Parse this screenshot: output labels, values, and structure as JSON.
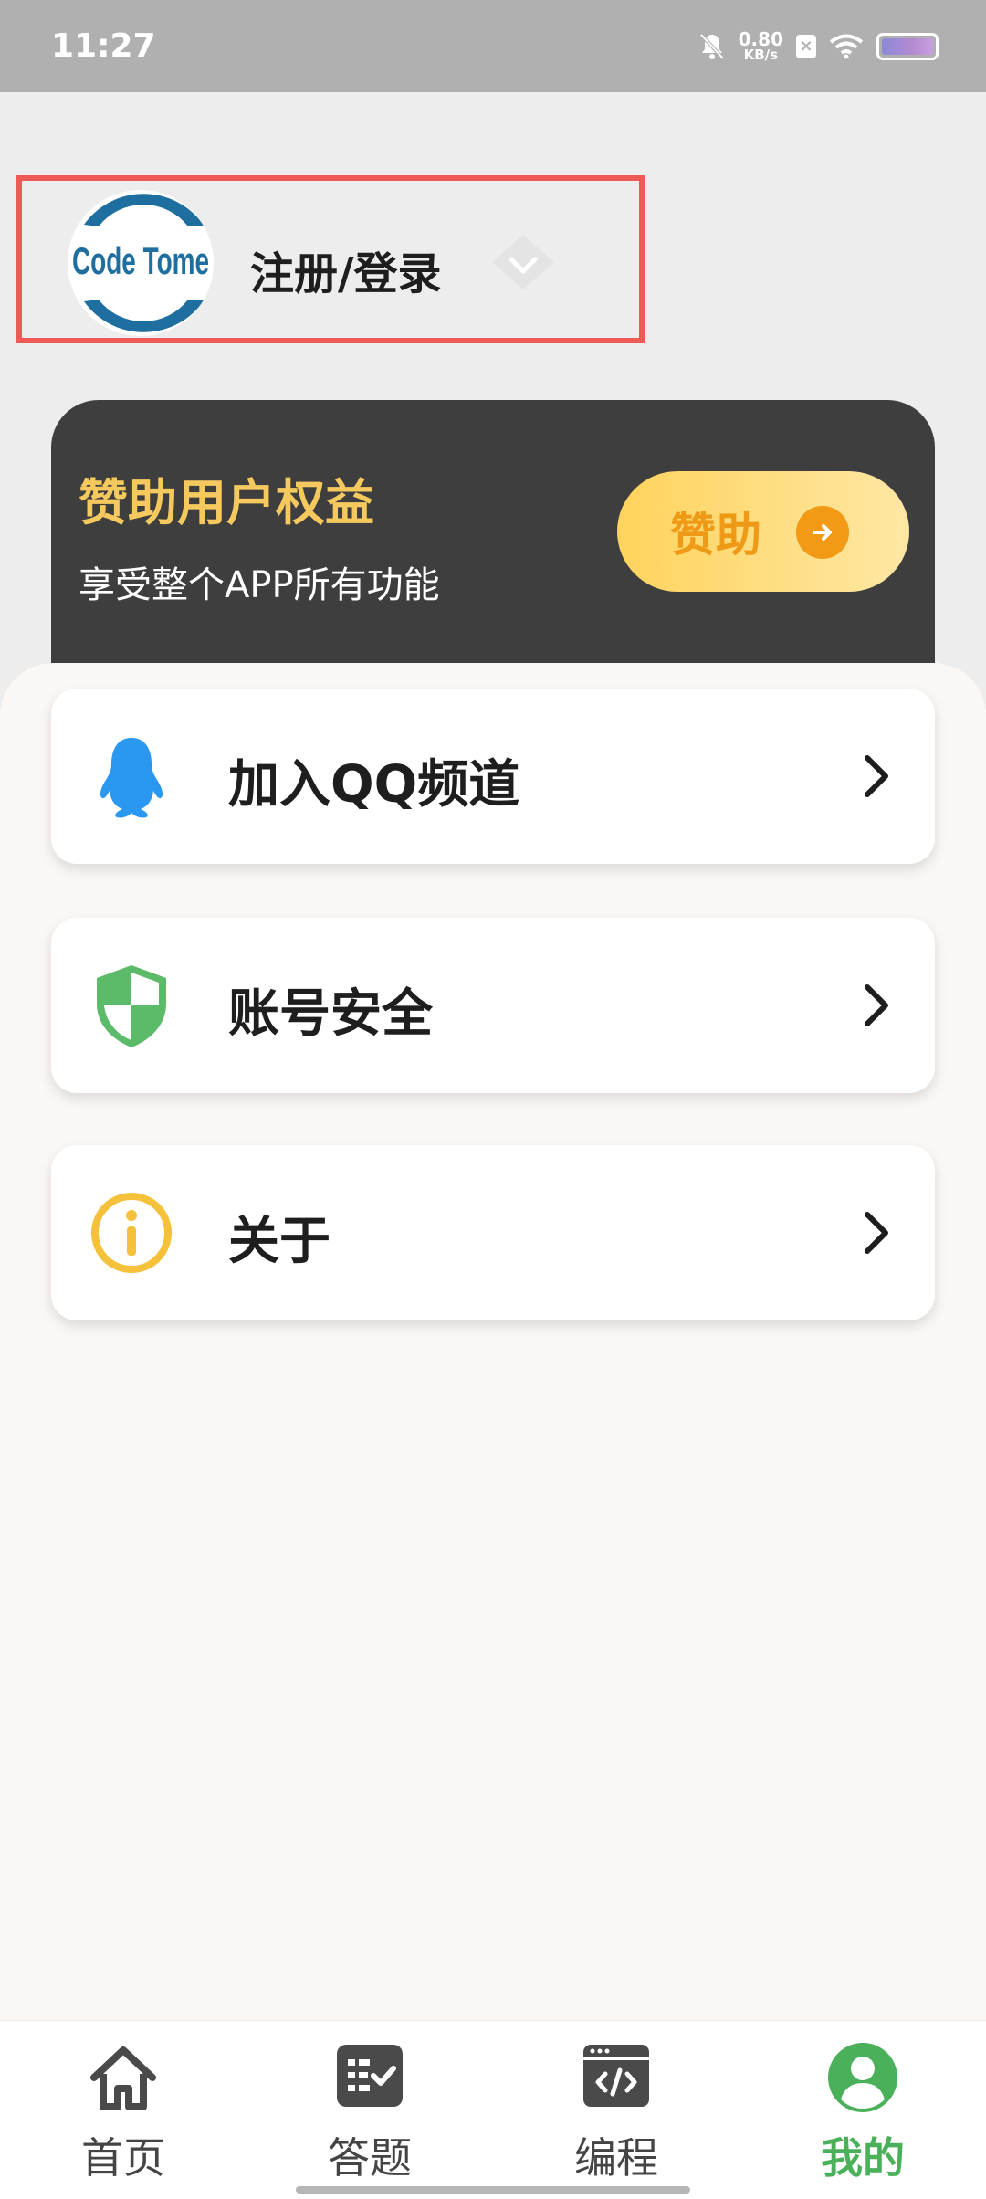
{
  "status_bar": {
    "time": "11:27",
    "net_speed_value": "0.80",
    "net_speed_unit": "KB/s",
    "sim_label": "×",
    "icons": [
      "bell-muted-icon",
      "sim-x-icon",
      "wifi-icon",
      "battery-icon"
    ]
  },
  "profile": {
    "avatar_logo_text": "Code Tome",
    "login_label": "注册/登录",
    "badge_icon": "diamond-icon"
  },
  "sponsor": {
    "title": "赞助用户权益",
    "subtitle": "享受整个APP所有功能",
    "button_label": "赞助",
    "colors": {
      "title": "#f5c95e",
      "button_text": "#ef9a16"
    }
  },
  "menu": [
    {
      "label": "加入QQ频道",
      "icon": "qq-penguin-icon",
      "color": "#2a97f0"
    },
    {
      "label": "账号安全",
      "icon": "shield-icon",
      "color": "#5cbb68"
    },
    {
      "label": "关于",
      "icon": "info-icon",
      "color": "#f5c13a"
    }
  ],
  "bottom_nav": {
    "items": [
      {
        "label": "首页",
        "icon": "home-icon"
      },
      {
        "label": "答题",
        "icon": "quiz-checklist-icon"
      },
      {
        "label": "编程",
        "icon": "code-window-icon"
      },
      {
        "label": "我的",
        "icon": "profile-icon"
      }
    ],
    "active": "我的",
    "active_color": "#4ab05a"
  }
}
